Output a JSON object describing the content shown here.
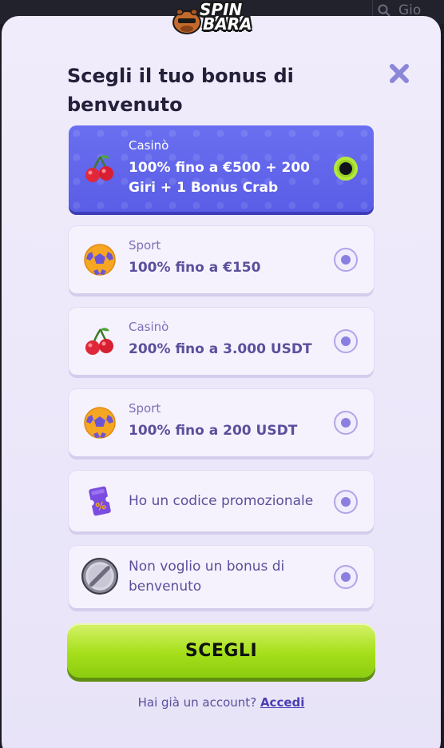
{
  "background": {
    "search_placeholder": "Gio"
  },
  "logo": {
    "line1": "SPIN",
    "line2": "BARA"
  },
  "modal": {
    "title": "Scegli il tuo bonus di benvenuto",
    "close_icon": "close-icon"
  },
  "options": [
    {
      "category": "Casinò",
      "text": "100% fino a €500 + 200 Giri + 1 Bonus Crab",
      "icon": "cherries-icon",
      "selected": true
    },
    {
      "category": "Sport",
      "text": "100% fino a €150",
      "icon": "soccer-ball-icon",
      "selected": false
    },
    {
      "category": "Casinò",
      "text": "200% fino a 3.000 USDT",
      "icon": "cherries-icon",
      "selected": false
    },
    {
      "category": "Sport",
      "text": "100% fino a 200 USDT",
      "icon": "soccer-ball-icon",
      "selected": false
    },
    {
      "category": "",
      "text": "Ho un codice promozionale",
      "icon": "promo-ticket-icon",
      "selected": false
    },
    {
      "category": "",
      "text": "Non voglio un bonus di benvenuto",
      "icon": "prohibited-icon",
      "selected": false
    }
  ],
  "cta": {
    "label": "SCEGLI"
  },
  "footer": {
    "question": "Hai già un account?",
    "link": "Accedi"
  },
  "colors": {
    "selected_option": "#5f62eb",
    "radio_selected": "#b4e83a",
    "cta": "#a6df1a",
    "accent_text": "#5b4f9c"
  }
}
